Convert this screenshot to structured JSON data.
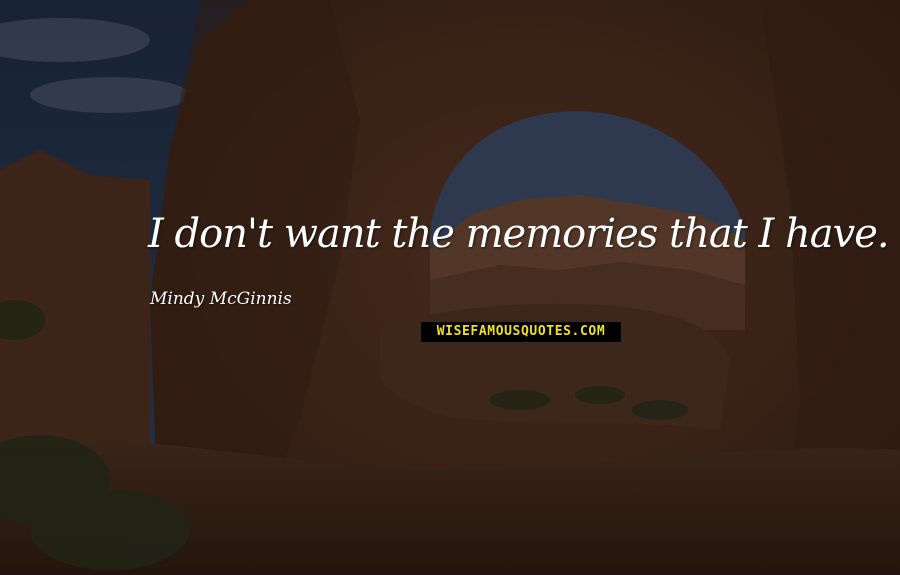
{
  "quote": {
    "text": "I don't want the memories that I have.",
    "author": "Mindy McGinnis"
  },
  "watermark": {
    "text": "WISEFAMOUSQUOTES.COM"
  },
  "colors": {
    "text": "#ffffff",
    "watermark_bg": "#000000",
    "watermark_text": "#f0e21a",
    "rock": "#4a2c1e",
    "sky": "#2b3b55"
  }
}
